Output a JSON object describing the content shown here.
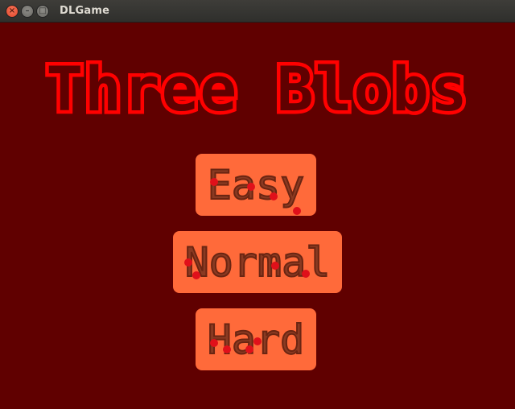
{
  "window": {
    "title": "DLGame",
    "controls": {
      "close_glyph": "×",
      "minimize_glyph": "–",
      "maximize_glyph": "□"
    }
  },
  "game": {
    "title": "Three Blobs",
    "menu": {
      "easy_label": "Easy",
      "normal_label": "Normal",
      "hard_label": "Hard"
    },
    "colors": {
      "background": "#600000",
      "title_outline": "#ff0000",
      "button_fill": "#ff6a3a",
      "button_text": "#8a3a22",
      "blob": "#e0101a"
    }
  }
}
